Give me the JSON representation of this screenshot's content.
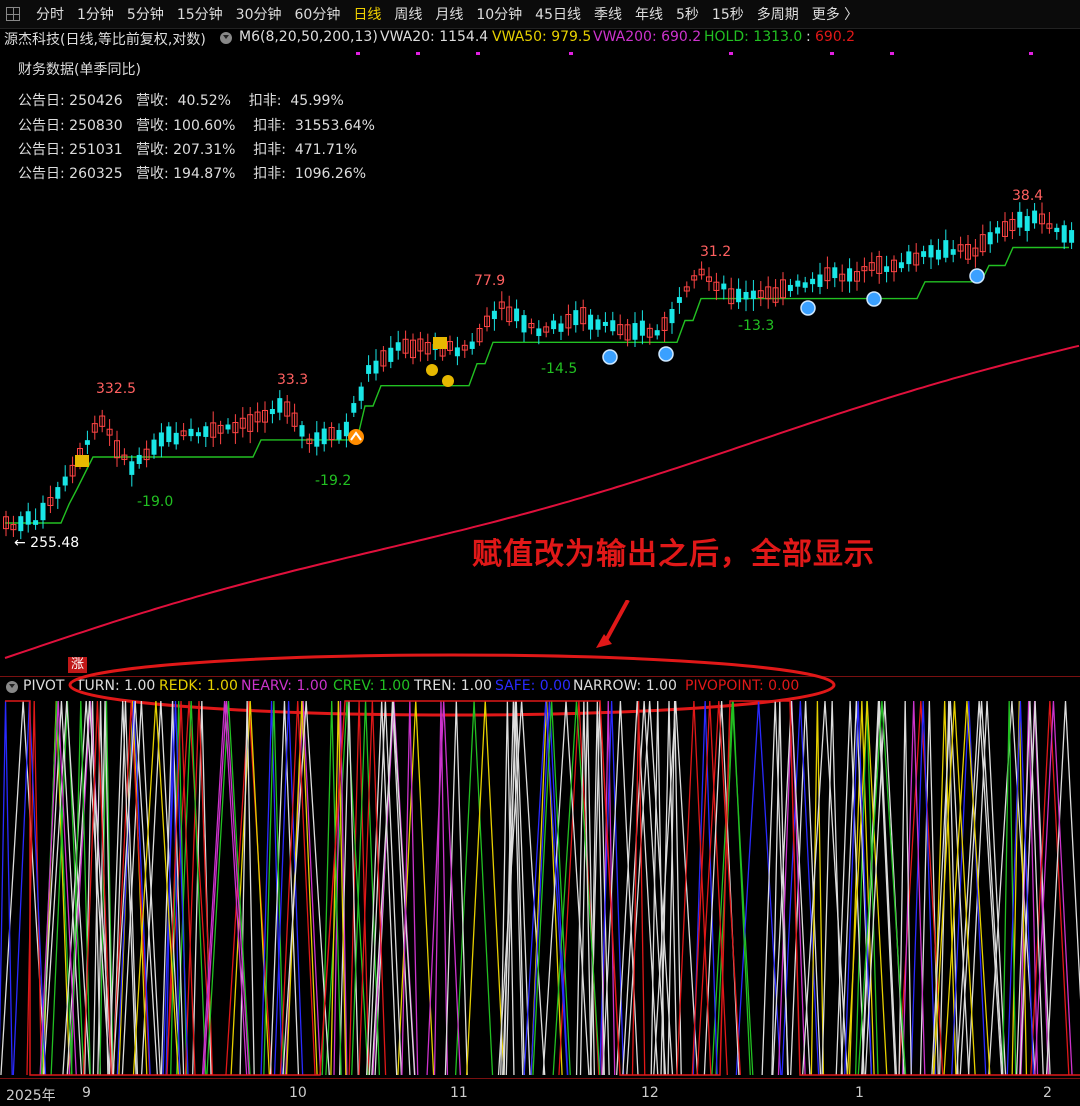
{
  "tabs": [
    "分时",
    "1分钟",
    "5分钟",
    "15分钟",
    "30分钟",
    "60分钟",
    "日线",
    "周线",
    "月线",
    "10分钟",
    "45日线",
    "季线",
    "年线",
    "5秒",
    "15秒",
    "多周期",
    "更多 〉"
  ],
  "active_tab": "日线",
  "info": {
    "stock": "源杰科技(日线,等比前复权,对数)",
    "m6": "M6(8,20,50,200,13)",
    "vwa20": "VWA20: 1154.4",
    "vwa50": "VWA50: 979.5",
    "vwa200": "VWA200: 690.2",
    "hold_label": "HOLD: 1313.0",
    "hold_sep": ":",
    "hold_value": "690.2"
  },
  "financial": {
    "title": "财务数据(单季同比)",
    "rows": [
      "公告日: 250426   营收:  40.52%    扣非:  45.99%",
      "公告日: 250830   营收: 100.60%    扣非:  31553.64%",
      "公告日: 251031   营收: 207.31%    扣非:  471.71%",
      "公告日: 260325   营收: 194.87%    扣非:  1096.26%"
    ]
  },
  "price_labels": {
    "p1": "332.5",
    "p2": "33.3",
    "p3": "77.9",
    "p4": "31.2",
    "p5": "38.4",
    "n1": "-19.0",
    "n2": "-19.2",
    "n3": "-14.5",
    "n4": "-13.3",
    "start": "← 255.48"
  },
  "annotation": "赋值改为输出之后，全部显示",
  "pivot": {
    "name": "PIVOT",
    "turn": "TURN: 1.00",
    "redk": "REDK: 1.00",
    "nearv": "NEARV: 1.00",
    "crev": "CREV: 1.00",
    "tren": "TREN: 1.00",
    "safe": "SAFE: 0.00",
    "narrow": "NARROW: 1.00",
    "pivopoint": "PIVOPOINT: 0.00"
  },
  "marker_zhang": "涨",
  "xaxis": [
    "2025年",
    "9",
    "10",
    "11",
    "12",
    "1",
    "2"
  ],
  "colors": {
    "up": "#ff4444",
    "down": "#19e6e6",
    "hold_line": "#22c022",
    "vwa200_line": "#e0103c",
    "vwa50": "#e6d000",
    "vwa200": "#cc33cc",
    "hold": "#22c022",
    "annotation": "#e01818"
  }
}
